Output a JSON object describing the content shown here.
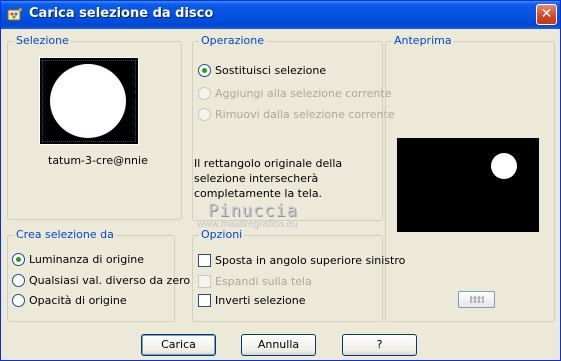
{
  "window": {
    "title": "Carica selezione da disco",
    "close_glyph": "✕"
  },
  "selezione": {
    "legend": "Selezione",
    "file_name": "tatum-3-cre@nnie"
  },
  "operazione": {
    "legend": "Operazione",
    "options": [
      {
        "label": "Sostituisci selezione",
        "selected": true,
        "enabled": true
      },
      {
        "label": "Aggiungi alla selezione corrente",
        "selected": false,
        "enabled": false
      },
      {
        "label": "Rimuovi dalla selezione corrente",
        "selected": false,
        "enabled": false
      }
    ],
    "info": "Il rettangolo originale della selezione intersecherà completamente la tela."
  },
  "anteprima": {
    "legend": "Anteprima"
  },
  "crea": {
    "legend": "Crea selezione da",
    "options": [
      {
        "label": "Luminanza di origine",
        "selected": true
      },
      {
        "label": "Qualsiasi val. diverso da zero",
        "selected": false
      },
      {
        "label": "Opacità di origine",
        "selected": false
      }
    ]
  },
  "opzioni": {
    "legend": "Opzioni",
    "options": [
      {
        "label": "Sposta in angolo superiore sinistro",
        "checked": false,
        "enabled": true
      },
      {
        "label": "Espandi sulla tela",
        "checked": false,
        "enabled": false
      },
      {
        "label": "Inverti selezione",
        "checked": false,
        "enabled": true
      }
    ]
  },
  "watermark": {
    "name": "Pinuccia",
    "url": "www.maidiregrafica.eu"
  },
  "buttons": {
    "carica": "Carica",
    "annulla": "Annulla",
    "help": "?"
  },
  "colors": {
    "titlebar": "#0553e0",
    "legend_text": "#0046d5",
    "dialog_bg": "#ece9d8",
    "radio_dot": "#21a121"
  }
}
